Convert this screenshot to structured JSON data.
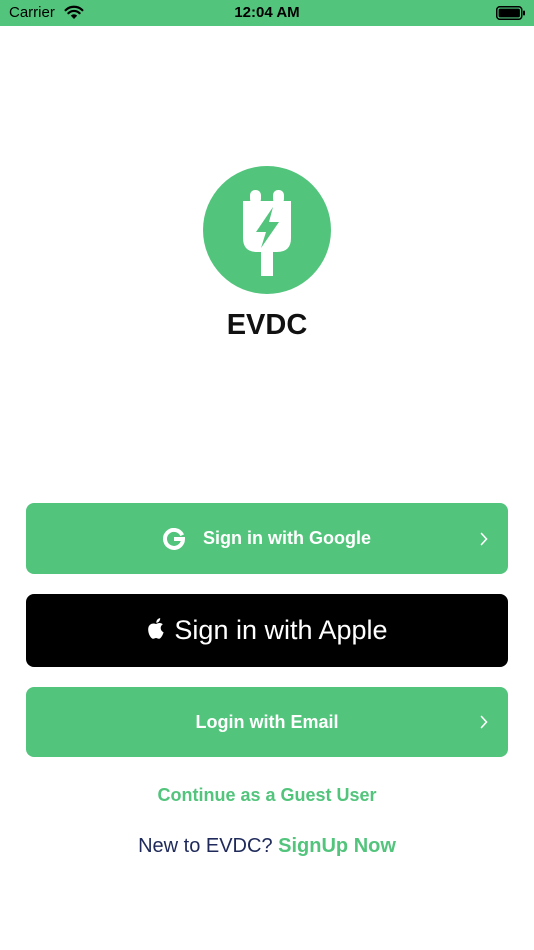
{
  "status_bar": {
    "carrier": "Carrier",
    "time": "12:04 AM",
    "icons": [
      "wifi-icon",
      "battery-icon"
    ],
    "color": "#52c47c"
  },
  "app": {
    "name": "EVDC",
    "logo_icon": "ev-plug-icon",
    "brand_color": "#52c47c"
  },
  "buttons": {
    "google": {
      "label": "Sign in with Google",
      "icon": "google-icon"
    },
    "apple": {
      "label": "Sign in with Apple",
      "icon": "apple-icon"
    },
    "email": {
      "label": "Login with Email"
    }
  },
  "links": {
    "guest": "Continue as a Guest User",
    "signup_prompt": "New to EVDC?",
    "signup": "SignUp Now"
  }
}
